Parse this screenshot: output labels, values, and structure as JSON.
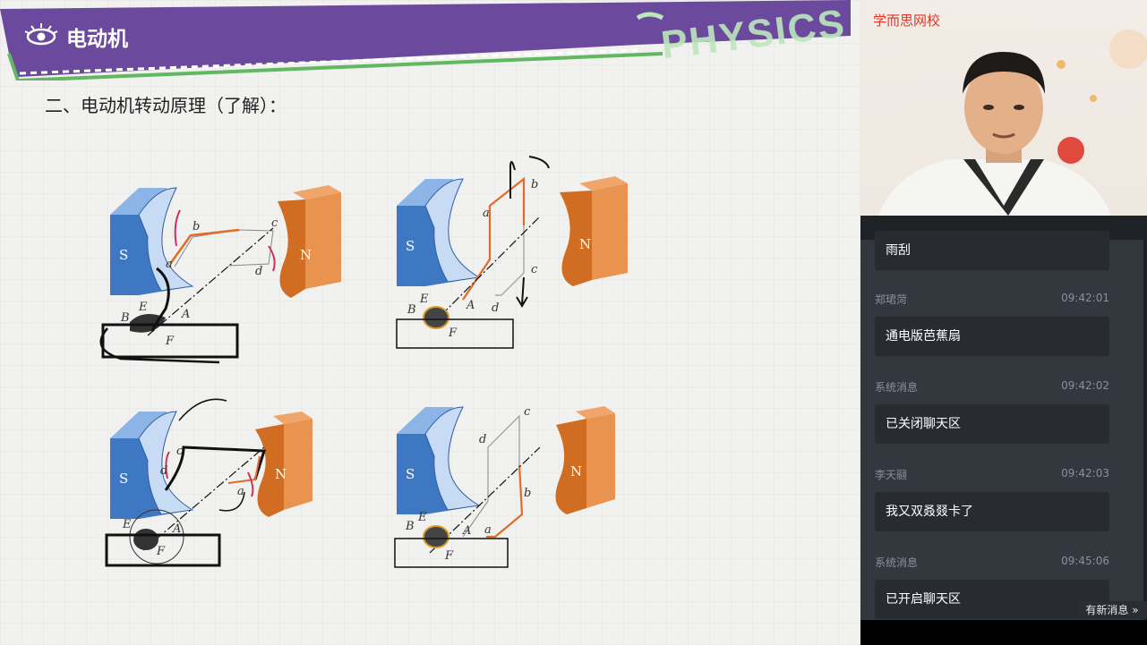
{
  "slide": {
    "title": "电动机",
    "watermark": "PHYSICS",
    "heading": "二、电动机转动原理（了解）：",
    "diagram_labels": {
      "pole_s": "S",
      "pole_n": "N",
      "a": "a",
      "b": "b",
      "c": "c",
      "d": "d",
      "A": "A",
      "B": "B",
      "E": "E",
      "F": "F"
    },
    "colors": {
      "banner": "#6b4a9e",
      "accent_green": "#62b762",
      "pole_s": "#3f78c2",
      "pole_n": "#d06d22",
      "coil": "#e46a2a",
      "ink": "#111111",
      "pen_red": "#d1305a"
    }
  },
  "video": {
    "brand": "学而思网校"
  },
  "chat": {
    "messages": [
      {
        "name": "",
        "time": "",
        "text": "雨刮"
      },
      {
        "name": "郑珺菏",
        "time": "09:42:01",
        "text": "通电版芭蕉扇"
      },
      {
        "name": "系统消息",
        "time": "09:42:02",
        "text": "已关闭聊天区"
      },
      {
        "name": "李天翮",
        "time": "09:42:03",
        "text": "我又双叒叕卡了"
      },
      {
        "name": "系统消息",
        "time": "09:45:06",
        "text": "已开启聊天区"
      }
    ],
    "new_messages": "有新消息 »"
  }
}
